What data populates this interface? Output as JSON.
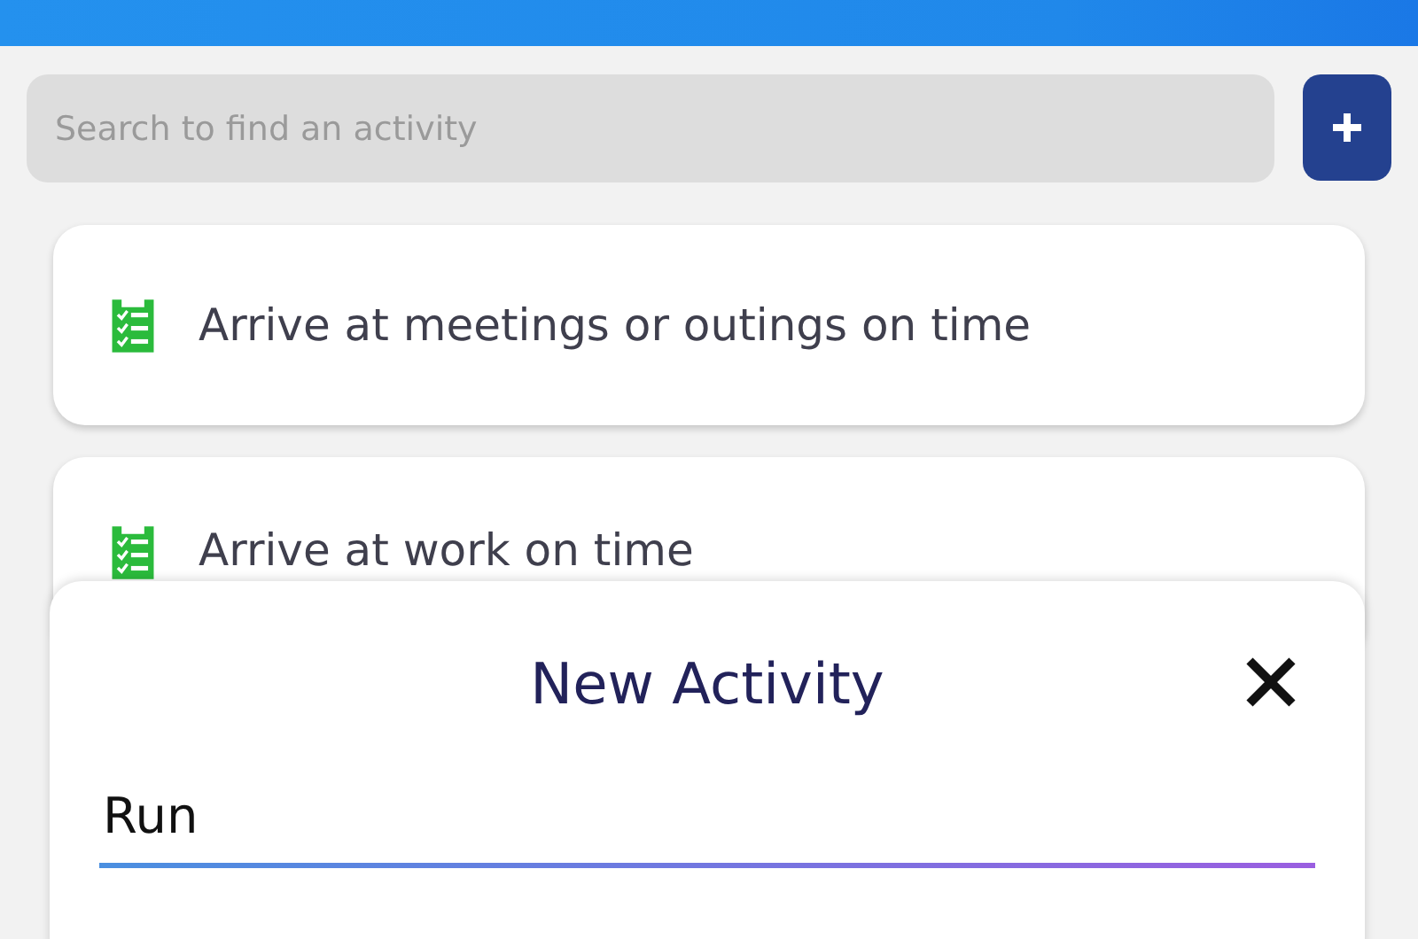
{
  "search": {
    "placeholder": "Search to find an activity"
  },
  "activities": [
    {
      "title": "Arrive at meetings or outings on time"
    },
    {
      "title": "Arrive at work on time"
    }
  ],
  "dialog": {
    "title": "New Activity",
    "input": {
      "value": "Run"
    }
  }
}
